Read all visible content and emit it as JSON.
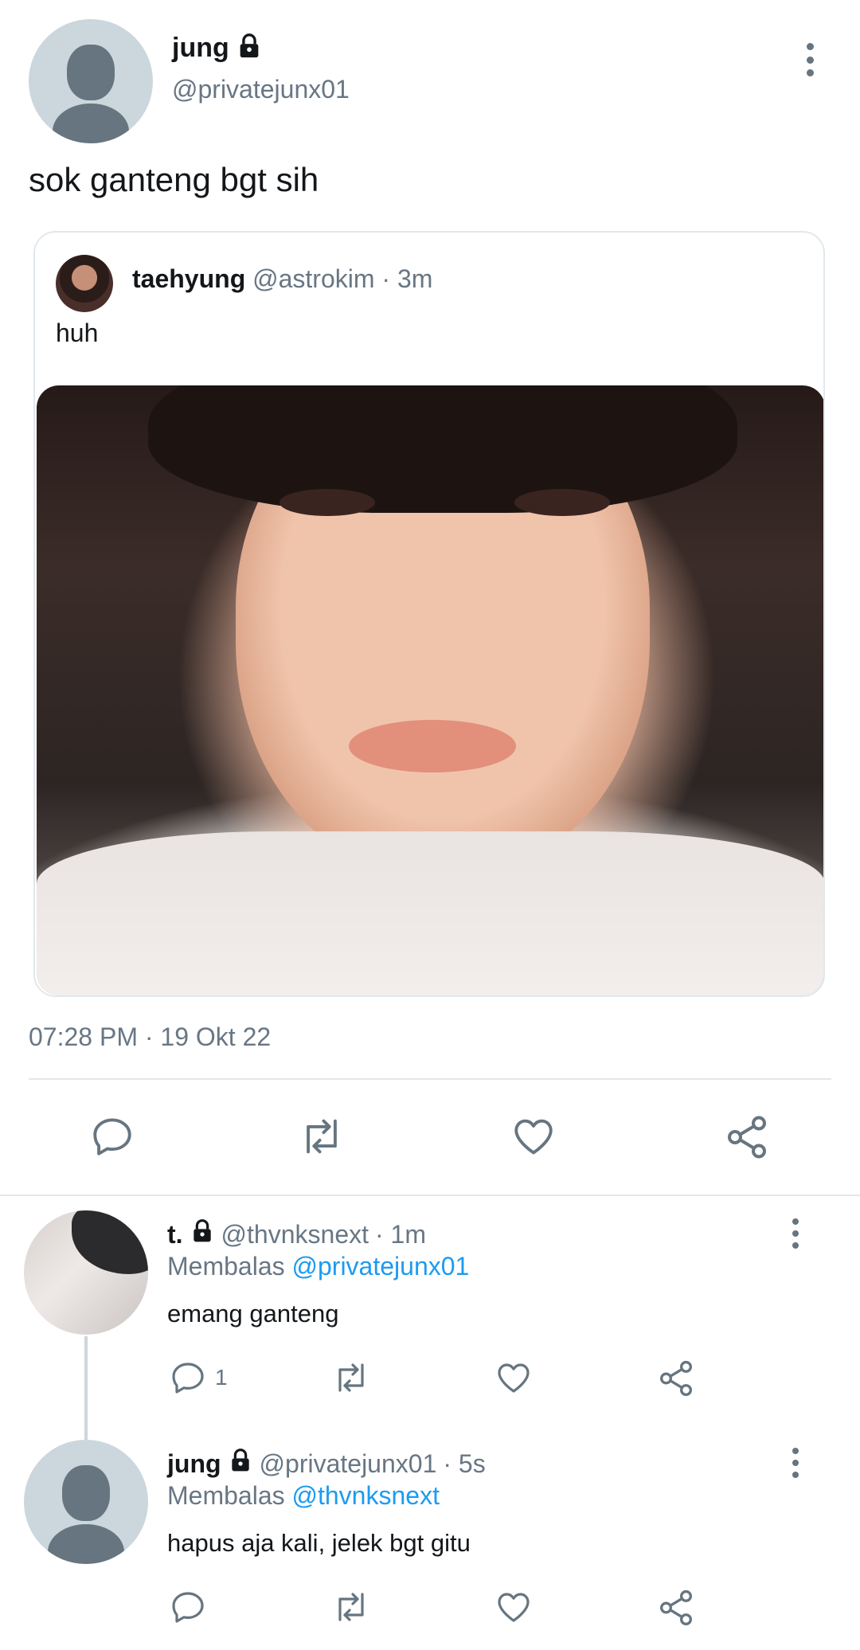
{
  "main_tweet": {
    "display_name": "jung",
    "handle": "@privatejunx01",
    "text": "sok ganteng bgt sih",
    "timestamp": "07:28 PM · 19 Okt 22",
    "quoted": {
      "display_name": "taehyung",
      "handle": "@astrokim",
      "time": "· 3m",
      "text": "huh"
    }
  },
  "replies": [
    {
      "display_name": "t.",
      "handle": "@thvnksnext",
      "time": "· 1m",
      "replying_prefix": "Membalas",
      "replying_to": "@privatejunx01",
      "text": "emang ganteng",
      "reply_count": "1"
    },
    {
      "display_name": "jung",
      "handle": "@privatejunx01",
      "time": "· 5s",
      "replying_prefix": "Membalas",
      "replying_to": "@thvnksnext",
      "text": "hapus aja kali, jelek bgt gitu"
    }
  ],
  "icons": {
    "lock": "lock-icon",
    "more": "more-vertical-icon",
    "reply": "reply-icon",
    "retweet": "retweet-icon",
    "like": "heart-icon",
    "share": "share-icon"
  },
  "colors": {
    "text": "#14171a",
    "muted": "#687684",
    "link": "#1d9bf0",
    "divider": "#e1e8ed",
    "icon": "#66757f"
  }
}
